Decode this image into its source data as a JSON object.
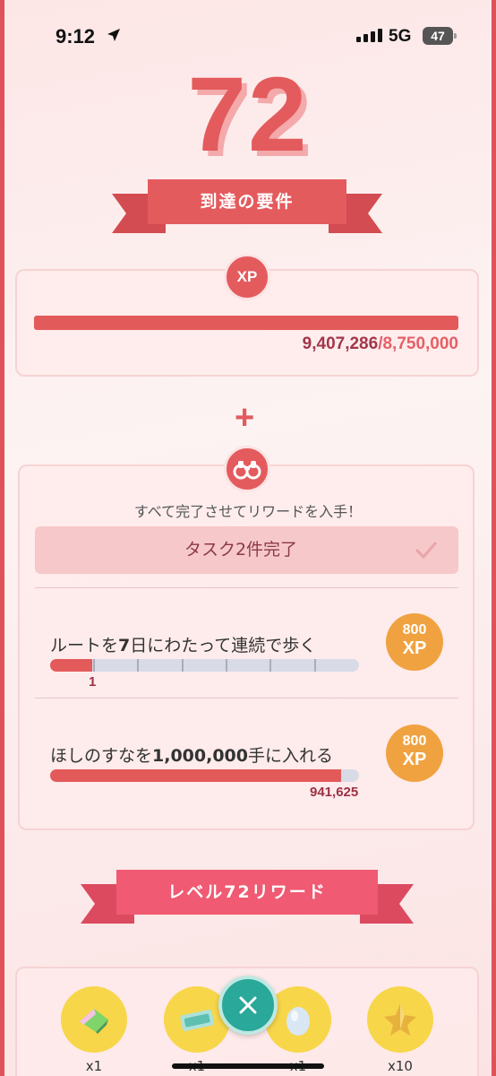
{
  "status_bar": {
    "time": "9:12",
    "network": "5G",
    "battery": "47"
  },
  "level": "72",
  "requirements_title": "到達の要件",
  "xp": {
    "badge": "XP",
    "current": "9,407,286",
    "separator": "/",
    "goal": "8,750,000",
    "progress": 1.0
  },
  "plus": "+",
  "tasks": {
    "subtitle": "すべて完了させてリワードを入手！",
    "completed_label": "タスク2件完了",
    "items": [
      {
        "label_pre": "ルートを",
        "label_bold": "7",
        "label_post": "日にわたって連続で歩く",
        "value": "1",
        "progress": 0.143,
        "reward_amount": "800",
        "reward_unit": "XP"
      },
      {
        "label_pre": "ほしのすなを",
        "label_bold": "1,000,000",
        "label_post": "手に入れる",
        "value": "941,625",
        "progress": 0.941625,
        "reward_amount": "800",
        "reward_unit": "XP"
      }
    ]
  },
  "rewards_title": "レベル72リワード",
  "rewards": [
    {
      "icon": "rare-candy-xl-icon",
      "count": "x1"
    },
    {
      "icon": "premium-pass-icon",
      "count": "x1"
    },
    {
      "icon": "egg-icon",
      "count": "x1"
    },
    {
      "icon": "star-piece-icon",
      "count": "x10"
    }
  ],
  "colors": {
    "accent": "#e45b5e",
    "ribbon2": "#f05a72",
    "xp_badge": "#f0a241",
    "close": "#2aa89a"
  }
}
